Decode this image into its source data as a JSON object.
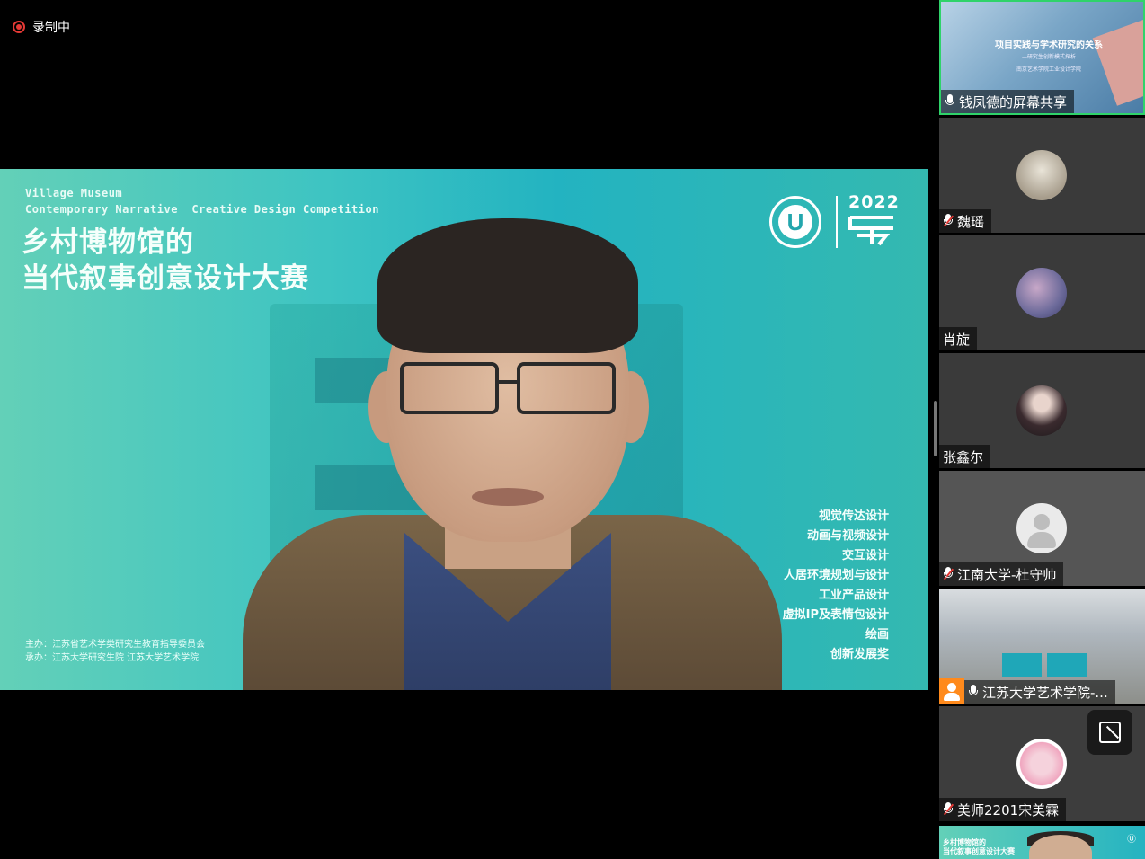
{
  "recording": {
    "label": "录制中",
    "indicator_color": "#e53935"
  },
  "stage": {
    "slide": {
      "en_title_lines": [
        "Village Museum",
        "Contemporary Narrative  Creative Design Competition"
      ],
      "cn_title_lines": [
        "乡村博物馆的",
        "当代叙事创意设计大赛"
      ],
      "logo_year": "2022",
      "categories": [
        "视觉传达设计",
        "动画与视频设计",
        "交互设计",
        "人居环境规划与设计",
        "工业产品设计",
        "虚拟IP及表情包设计",
        "绘画",
        "创新发展奖"
      ],
      "organizer_lines": [
        "主办：江苏省艺术学类研究生教育指导委员会",
        "承办：江苏大学研究生院    江苏大学艺术学院"
      ]
    }
  },
  "participants": [
    {
      "name": "钱凤德的屏幕共享",
      "mic": "on",
      "kind": "screen-share",
      "share_title": "项目实践与学术研究的关系",
      "share_subtitle": "—研究生创新模式探析",
      "share_note": "南京艺术学院工业设计学院"
    },
    {
      "name": "魏瑶",
      "mic": "muted",
      "kind": "avatar"
    },
    {
      "name": "肖旋",
      "mic": "none",
      "kind": "avatar"
    },
    {
      "name": "张鑫尔",
      "mic": "none",
      "kind": "avatar"
    },
    {
      "name": "江南大学-杜守帅",
      "mic": "muted",
      "kind": "default-avatar"
    },
    {
      "name": "江苏大学艺术学院-...",
      "mic": "on",
      "kind": "video"
    },
    {
      "name": "美师2201宋美霖",
      "mic": "muted",
      "kind": "avatar"
    },
    {
      "name": "",
      "mic": "none",
      "kind": "video-mini",
      "mini_title_lines": [
        "乡村博物馆的",
        "当代叙事创意设计大赛"
      ]
    }
  ],
  "colors": {
    "active_speaker_border": "#2fd36a",
    "host_badge": "#ff8a1c",
    "muted": "#e53935"
  },
  "icons": {
    "float_button": "whiteboard-edit-icon",
    "mic": "microphone-icon",
    "mic_muted": "microphone-muted-icon",
    "host": "host-person-icon"
  }
}
